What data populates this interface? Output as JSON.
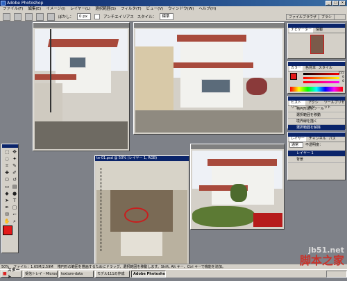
{
  "window": {
    "title": "Adobe Photoshop"
  },
  "menu": {
    "items": [
      "ファイル(F)",
      "編集(E)",
      "イメージ(I)",
      "レイヤー(L)",
      "選択範囲(S)",
      "フィルタ(T)",
      "ビュー(V)",
      "ウィンドウ(W)",
      "ヘルプ(H)"
    ]
  },
  "options": {
    "feather_label": "ぼかし：",
    "feather_value": "0 px",
    "antialias_label": "アンチエイリアス",
    "style_label": "スタイル：",
    "style_value": "標準"
  },
  "palette_well": {
    "tabs": [
      "ファイルブラウザ",
      "ブラシ"
    ]
  },
  "documents": [
    {
      "title": ""
    },
    {
      "title": ""
    },
    {
      "title": "te-01.psd @ 50% (レイヤー 1, RGB)"
    },
    {
      "title": ""
    }
  ],
  "palettes": {
    "navigator": {
      "tabs": [
        "ナビゲーター",
        "情報"
      ]
    },
    "color": {
      "tabs": [
        "カラー",
        "色見本",
        "スタイル"
      ],
      "r_value": "255",
      "g_value": "0",
      "b_value": "0",
      "accent": "#e21a1a"
    },
    "history": {
      "tabs": [
        "ヒストリー",
        "アクション",
        "ツールプリセット"
      ],
      "items": [
        "楕円形選択ツール",
        "選択範囲を移動",
        "境界線を描く",
        "選択範囲を解除"
      ]
    },
    "layers": {
      "tabs": [
        "レイヤー",
        "チャンネル",
        "パス"
      ],
      "mode": "通常",
      "opacity_label": "不透明度：",
      "layer_names": [
        "レイヤー 1",
        "背景"
      ]
    }
  },
  "status": {
    "zoom": "50%",
    "file_info": "ファイル：1.65M/2.59M",
    "hint": "楕円形の範囲を描画するためにドラッグ、選択範囲を移動します。Shift, Alt キー、Ctrl キーで機能を追加。"
  },
  "taskbar": {
    "start_label": "スタート",
    "tasks": [
      "受信トレイ - Microsoft O...",
      "texture-data",
      "モデル111の作成",
      "Adobe Photoshop"
    ]
  },
  "watermark": {
    "url": "jb51.net",
    "chinese": "脚本之家"
  }
}
